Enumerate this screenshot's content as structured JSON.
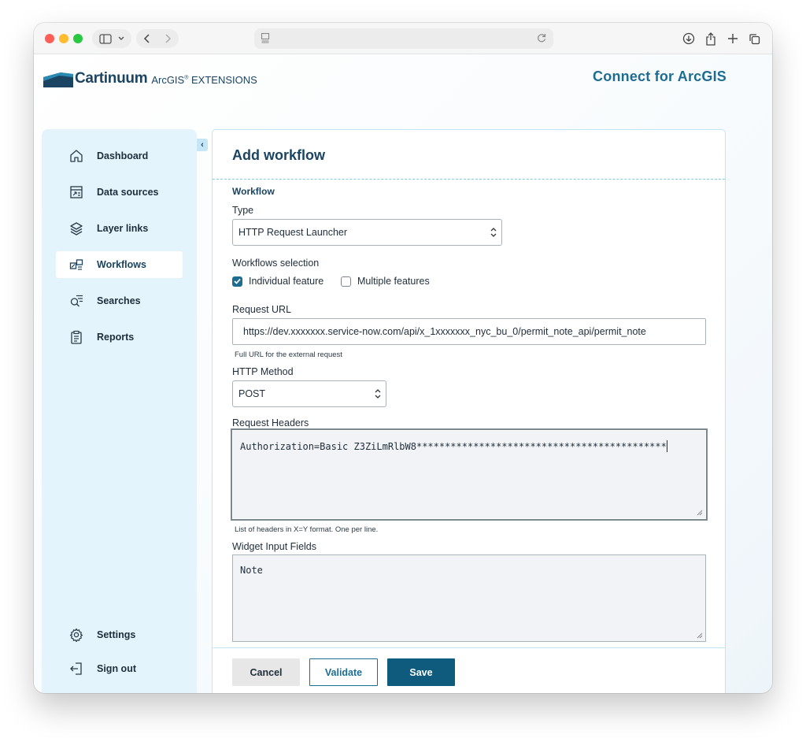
{
  "browser": {
    "colors": {
      "close": "#ff5f57",
      "minimize": "#febc2e",
      "zoom": "#28c840"
    },
    "icons": [
      "sidebar-toggle-icon",
      "chevron-down-icon",
      "back-arrow-icon",
      "forward-arrow-icon",
      "page-icon",
      "reload-icon",
      "download-icon",
      "share-icon",
      "new-tab-icon",
      "tab-overview-icon"
    ]
  },
  "header": {
    "brand_name": "Cartinuum",
    "brand_sub": "ArcGIS",
    "brand_sub_sup": "®",
    "brand_sub_tail": " EXTENSIONS",
    "app_title": "Connect for ArcGIS"
  },
  "sidebar": {
    "collapse_glyph": "‹",
    "items": [
      {
        "label": "Dashboard",
        "icon": "home-icon"
      },
      {
        "label": "Data sources",
        "icon": "data-source-icon"
      },
      {
        "label": "Layer links",
        "icon": "layers-icon"
      },
      {
        "label": "Workflows",
        "icon": "workflow-icon",
        "active": true
      },
      {
        "label": "Searches",
        "icon": "search-list-icon"
      },
      {
        "label": "Reports",
        "icon": "clipboard-icon"
      }
    ],
    "bottom_items": [
      {
        "label": "Settings",
        "icon": "gear-icon"
      },
      {
        "label": "Sign out",
        "icon": "sign-out-icon"
      }
    ]
  },
  "form": {
    "title": "Add workflow",
    "section": "Workflow",
    "type_label": "Type",
    "type_value": "HTTP Request Launcher",
    "selection_label": "Workflows selection",
    "option_individual": "Individual feature",
    "option_individual_checked": true,
    "option_multiple": "Multiple features",
    "option_multiple_checked": false,
    "url_label": "Request URL",
    "url_value": "https://dev.xxxxxxx.service-now.com/api/x_1xxxxxxx_nyc_bu_0/permit_note_api/permit_note",
    "url_help": "Full URL for the external request",
    "method_label": "HTTP Method",
    "method_value": "POST",
    "headers_label": "Request Headers",
    "headers_value": "Authorization=Basic Z3ZiLmRlbW8********************************************",
    "headers_help": "List of headers in X=Y format. One per line.",
    "widget_label": "Widget Input Fields",
    "widget_value": "Note"
  },
  "footer": {
    "cancel_label": "Cancel",
    "validate_label": "Validate",
    "save_label": "Save"
  },
  "colors": {
    "brand_dark": "#1b4462",
    "accent": "#1d6d92",
    "primary_button": "#0e5b7e",
    "sidebar_bg": "#e3f4fc"
  }
}
